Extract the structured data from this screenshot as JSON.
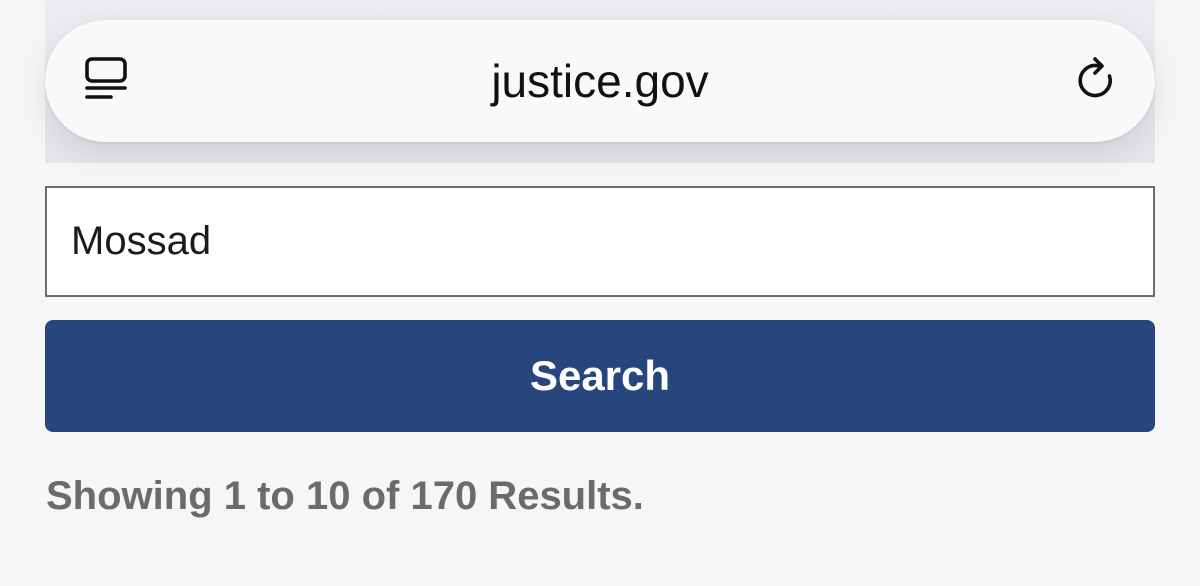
{
  "browser": {
    "url": "justice.gov",
    "icons": {
      "page_menu": "page-menu-icon",
      "reload": "reload-icon"
    }
  },
  "search": {
    "value": "Mossad",
    "button_label": "Search"
  },
  "results": {
    "summary": "Showing 1 to 10 of 170 Results."
  },
  "colors": {
    "button_bg": "#26467d",
    "button_text": "#ffffff",
    "results_text": "#6b6b6b",
    "input_border": "#6d6d6d"
  }
}
